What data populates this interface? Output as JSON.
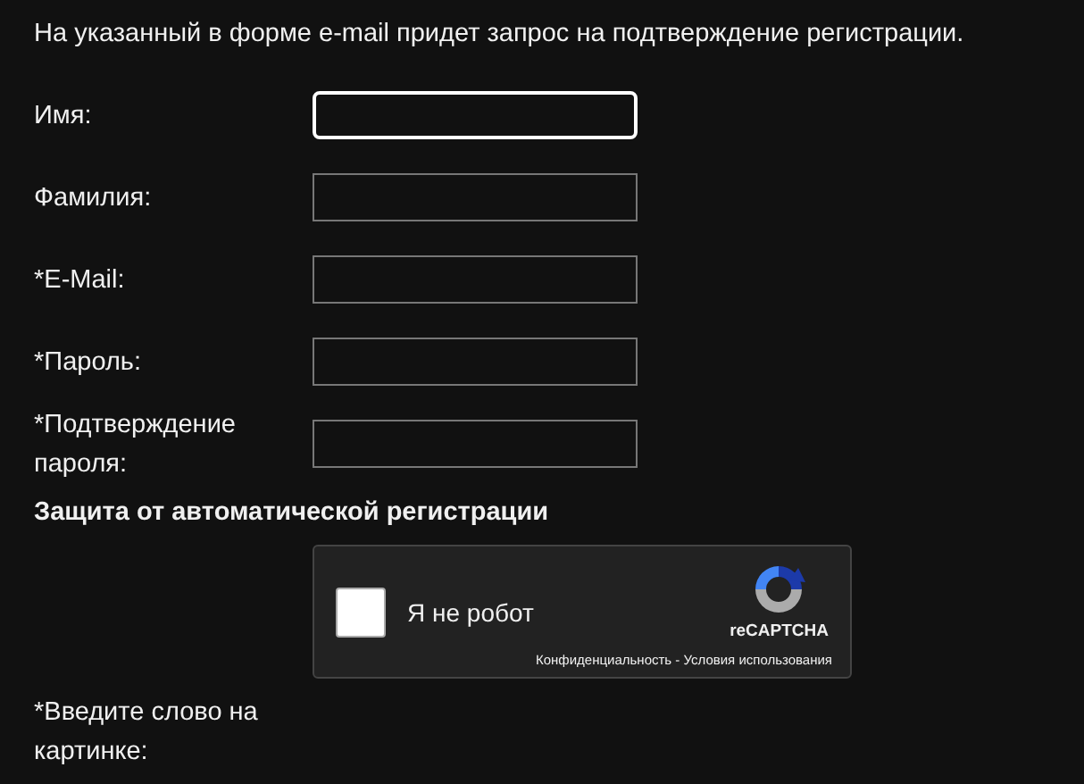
{
  "intro": "На указанный в форме e-mail придет запрос на подтверждение регистрации.",
  "fields": [
    {
      "label": "Имя:",
      "focused": true
    },
    {
      "label": "Фамилия:",
      "focused": false
    },
    {
      "label": "*E-Mail:",
      "focused": false
    },
    {
      "label": "*Пароль:",
      "focused": false
    },
    {
      "label": "*Подтверждение пароля:",
      "focused": false
    }
  ],
  "captcha_heading": "Защита от автоматической регистрации",
  "captcha": {
    "checked": false,
    "label": "Я не робот",
    "brand": "reCAPTCHA",
    "links": "Конфиденциальность - Условия использования"
  },
  "word_label": "*Введите слово на картинке:"
}
